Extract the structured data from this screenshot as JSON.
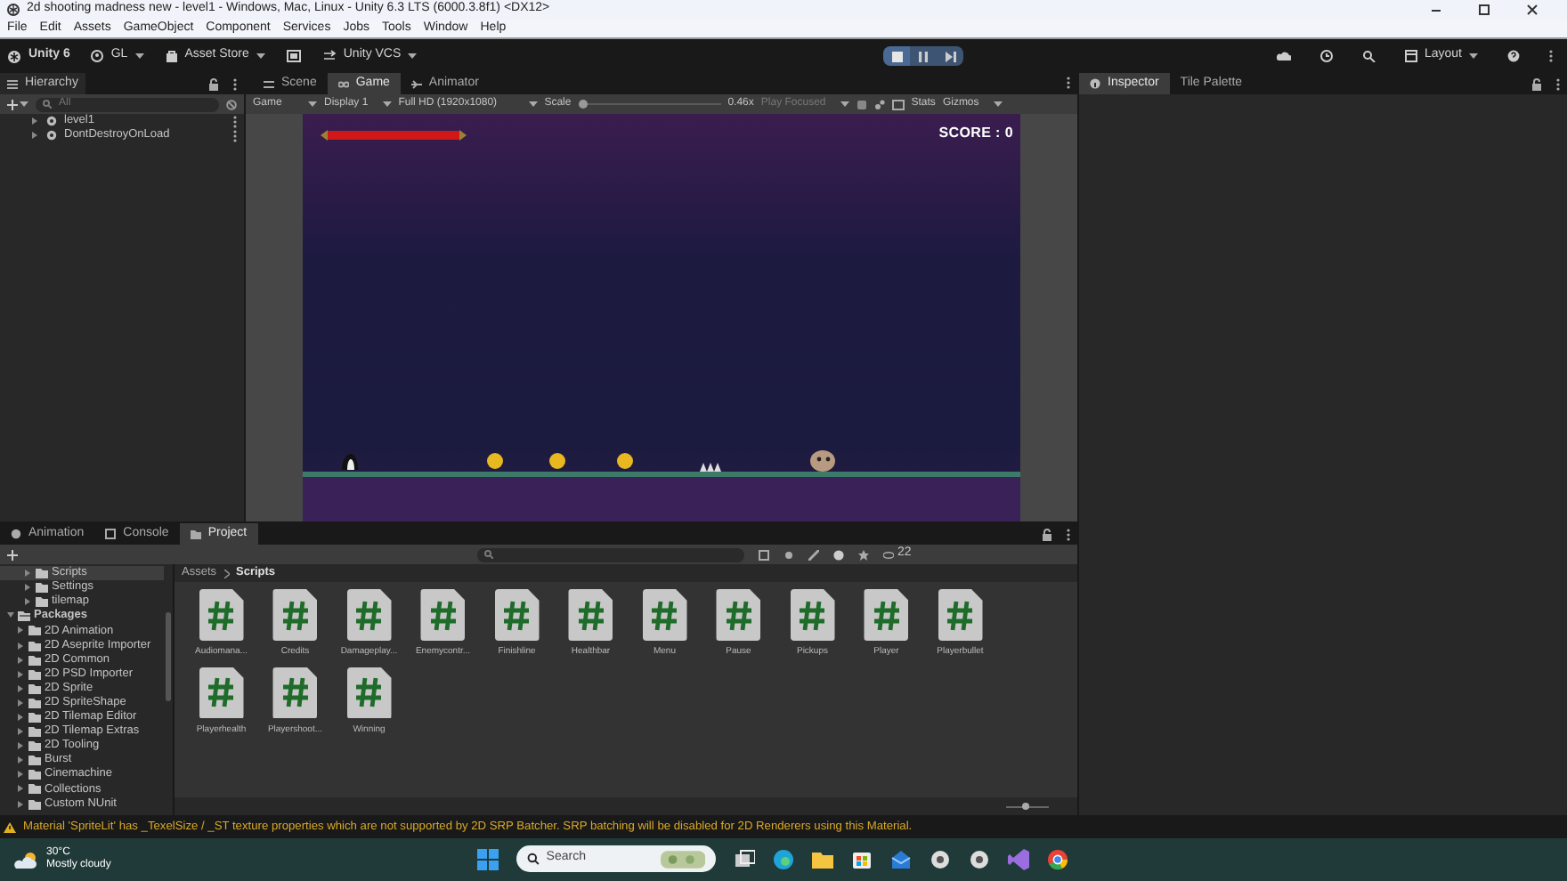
{
  "window": {
    "title": "2d shooting madness new - level1 - Windows, Mac, Linux - Unity 6.3 LTS (6000.3.8f1) <DX12>"
  },
  "menu": [
    "File",
    "Edit",
    "Assets",
    "GameObject",
    "Component",
    "Services",
    "Jobs",
    "Tools",
    "Window",
    "Help"
  ],
  "toolbar": {
    "unity": "Unity 6",
    "account": "GL",
    "asset_store": "Asset Store",
    "vcs": "Unity VCS",
    "playing": true,
    "paused": false,
    "layout": "Layout"
  },
  "hierarchy": {
    "tab": "Hierarchy",
    "search_placeholder": "All",
    "items": [
      {
        "label": "level1",
        "expanded": false
      },
      {
        "label": "DontDestroyOnLoad",
        "expanded": false
      }
    ]
  },
  "scene_tabs": [
    {
      "label": "Scene",
      "selected": false
    },
    {
      "label": "Game",
      "selected": true
    },
    {
      "label": "Animator",
      "selected": false
    }
  ],
  "game_toolbar": {
    "mode": "Game",
    "display": "Display 1",
    "resolution": "Full HD (1920x1080)",
    "scale_label": "Scale",
    "scale": {
      "level": 0.0,
      "reading": "0.46x"
    },
    "play_focused": "Play Focused",
    "stats": "Stats",
    "gizmos": "Gizmos"
  },
  "game_view": {
    "score": "SCORE : 0"
  },
  "inspector_tabs": [
    {
      "label": "Inspector",
      "selected": true
    },
    {
      "label": "Tile Palette",
      "selected": false
    }
  ],
  "bottom_tabs": [
    {
      "label": "Animation",
      "selected": false
    },
    {
      "label": "Console",
      "selected": false
    },
    {
      "label": "Project",
      "selected": true
    }
  ],
  "project": {
    "hidden_count": "22",
    "asset_folders": [
      {
        "label": "Scripts",
        "selected": true,
        "expanded": false
      },
      {
        "label": "Settings",
        "selected": false,
        "expanded": false
      },
      {
        "label": "tilemap",
        "selected": false,
        "expanded": false
      }
    ],
    "packages": {
      "label": "Packages",
      "expanded": true,
      "children": [
        {
          "label": "2D Animation"
        },
        {
          "label": "2D Aseprite Importer"
        },
        {
          "label": "2D Common"
        },
        {
          "label": "2D PSD Importer"
        },
        {
          "label": "2D Sprite"
        },
        {
          "label": "2D SpriteShape"
        },
        {
          "label": "2D Tilemap Editor"
        },
        {
          "label": "2D Tilemap Extras"
        },
        {
          "label": "2D Tooling"
        },
        {
          "label": "Burst"
        },
        {
          "label": "Cinemachine"
        },
        {
          "label": "Collections"
        },
        {
          "label": "Custom NUnit"
        }
      ]
    },
    "breadcrumb": [
      "Assets",
      "Scripts"
    ],
    "icon_size": {
      "level": 0.45
    },
    "files": [
      "Audiomana...",
      "Credits",
      "Damageplay...",
      "Enemycontr...",
      "Finishline",
      "Healthbar",
      "Menu",
      "Pause",
      "Pickups",
      "Player",
      "Playerbullet",
      "Playerhealth",
      "Playershoot...",
      "Winning"
    ]
  },
  "status_bar": {
    "message": "Material 'SpriteLit' has _TexelSize / _ST texture properties which are not supported by 2D SRP Batcher. SRP batching will be disabled for 2D Renderers using this Material."
  },
  "taskbar": {
    "temperature": "30°C",
    "weather": "Mostly cloudy",
    "search_placeholder": "Search"
  }
}
